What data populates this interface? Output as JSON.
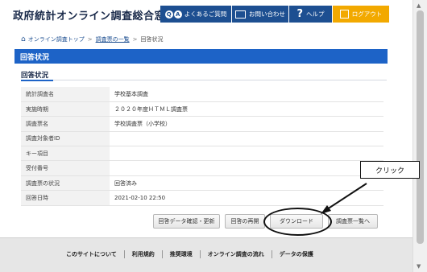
{
  "header": {
    "site_title": "政府統計オンライン調査総合窓口",
    "nav": {
      "faq_icon_q": "Q",
      "faq_icon_a": "A",
      "faq_label": "よくあるご質問",
      "contact_label": "お問い合わせ",
      "help_label": "ヘルプ",
      "logout_label": "ログアウト"
    }
  },
  "breadcrumb": {
    "home": "オンライン調査トップ",
    "sep": ">",
    "list": "調査票の一覧",
    "current": "回答状況"
  },
  "page": {
    "title": "回答状況",
    "section_title": "回答状況"
  },
  "table": {
    "rows": [
      {
        "label": "統計調査名",
        "value": "学校基本調査"
      },
      {
        "label": "実施時期",
        "value": "２０２０年度ＨＴＭＬ調査票"
      },
      {
        "label": "調査票名",
        "value": "学校調査票（小学校）"
      },
      {
        "label": "調査対象者ID",
        "value": ""
      },
      {
        "label": "キー項目",
        "value": ""
      },
      {
        "label": "受付番号",
        "value": ""
      },
      {
        "label": "調査票の状況",
        "value": "回答済み"
      },
      {
        "label": "回答日時",
        "value": "2021-02-10 22:50"
      }
    ]
  },
  "actions": {
    "confirm_print": "回答データ確認・更新",
    "reopen": "回答の再開",
    "download": "ダウンロード",
    "back_to_list": "調査票一覧へ"
  },
  "annotation": {
    "callout": "クリック"
  },
  "footer": {
    "links": [
      "このサイトについて",
      "利用規約",
      "推奨環境",
      "オンライン調査の流れ",
      "データの保護"
    ]
  },
  "colors": {
    "brand_blue": "#1d63c7",
    "nav_blue": "#1d4f91",
    "logout_orange": "#f2a900"
  }
}
